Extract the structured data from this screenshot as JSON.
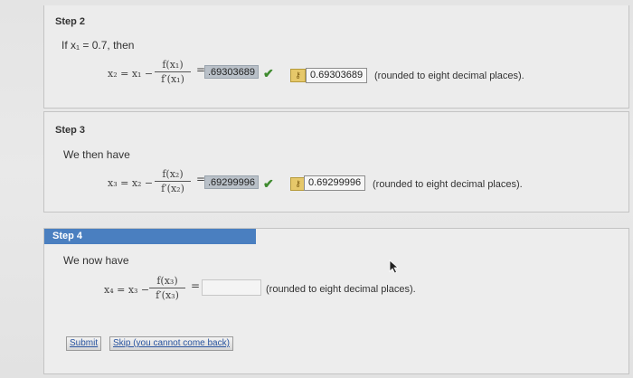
{
  "step2": {
    "label": "Step 2",
    "intro": "If x₁ = 0.7, then",
    "lhs": "x₂ = x₁ −",
    "num": "f(x₁)",
    "den": "f′(x₁)",
    "eq": "=",
    "entered": ".69303689",
    "final": "0.69303689",
    "note": "(rounded to eight decimal places)."
  },
  "step3": {
    "label": "Step 3",
    "intro": "We then have",
    "lhs": "x₃ = x₂ −",
    "num": "f(x₂)",
    "den": "f′(x₂)",
    "eq": "=",
    "entered": ".69299996",
    "final": "0.69299996",
    "note": "(rounded to eight decimal places)."
  },
  "step4": {
    "label": "Step 4",
    "intro": "We now have",
    "lhs": "x₄ = x₃ −",
    "num": "f(x₃)",
    "den": "f′(x₃)",
    "eq": "=",
    "entered": "",
    "note": "(rounded to eight decimal places).",
    "submit_label": "Submit",
    "skip_label": "Skip (you cannot come back)"
  },
  "icons": {
    "check": "check-icon",
    "key": "key-icon",
    "cursor": "cursor-icon"
  },
  "colors": {
    "step_tab": "#4a7fc0",
    "check": "#3e8a2e",
    "key": "#e6c86a"
  }
}
